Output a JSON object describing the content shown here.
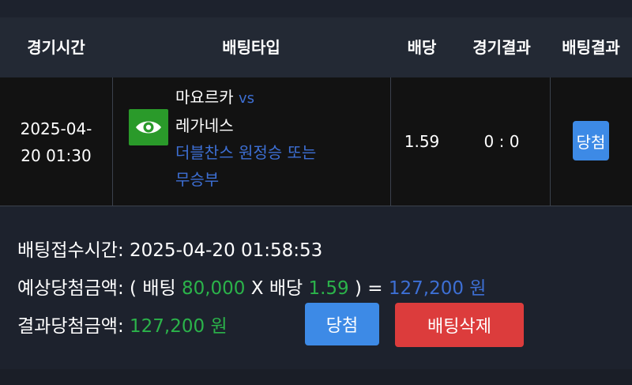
{
  "headers": {
    "time": "경기시간",
    "bettype": "배팅타입",
    "odds": "배당",
    "match_result": "경기결과",
    "bet_result": "배팅결과"
  },
  "row": {
    "date": "2025-04-",
    "time": "20 01:30",
    "icon": "eye-icon",
    "home_team": "마요르카",
    "vs": "vs",
    "away_team": "레가네스",
    "pick_line1": "더블찬스 원정승 또는",
    "pick_line2": "무승부",
    "odds": "1.59",
    "score": "0 : 0",
    "result_badge": "당첨"
  },
  "info": {
    "received_label": "배팅접수시간:",
    "received_value": "2025-04-20 01:58:53",
    "expected_label": "예상당첨금액:",
    "open_paren": "( 배팅",
    "bet_amount": "80,000",
    "x_odds": "X 배당",
    "odds_value": "1.59",
    "close_eq": ") =",
    "expected_amount": "127,200 원",
    "result_label": "결과당첨금액:",
    "result_amount": "127,200 원"
  },
  "buttons": {
    "win": "당첨",
    "delete": "배팅삭제"
  },
  "colors": {
    "green": "#2bb34a",
    "blue": "#3d6fd4",
    "button_blue": "#3d8ae6",
    "button_red": "#dc3c3c"
  }
}
